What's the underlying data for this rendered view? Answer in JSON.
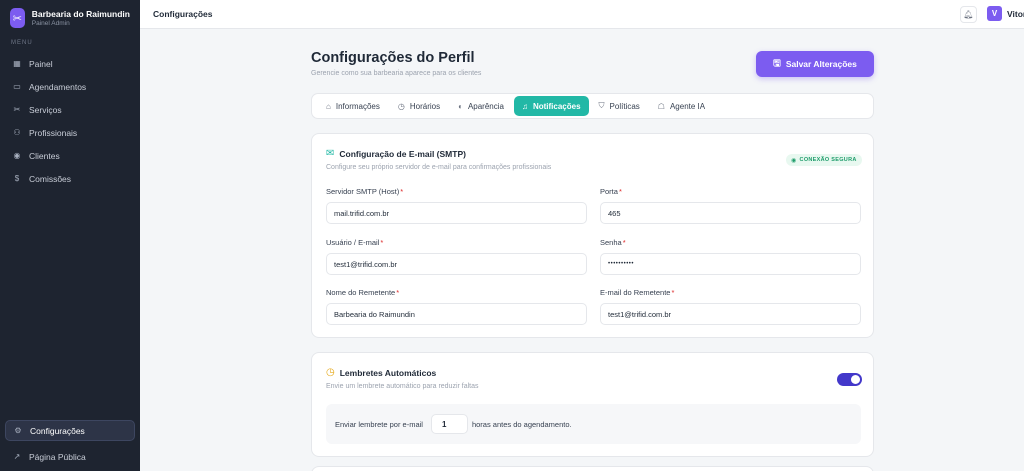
{
  "sidebar": {
    "brand_name": "Barbearia do Raimundin",
    "brand_sub": "Painel Admin",
    "menu_label": "MENU",
    "items": [
      {
        "label": "Painel",
        "icon": "grid-icon"
      },
      {
        "label": "Agendamentos",
        "icon": "calendar-icon"
      },
      {
        "label": "Serviços",
        "icon": "scissors-icon"
      },
      {
        "label": "Profissionais",
        "icon": "users-icon"
      },
      {
        "label": "Clientes",
        "icon": "user-circle-icon"
      },
      {
        "label": "Comissões",
        "icon": "dollar-icon"
      }
    ],
    "bottom": [
      {
        "label": "Configurações",
        "icon": "gear-icon",
        "active": true
      },
      {
        "label": "Página Pública",
        "icon": "external-link-icon"
      }
    ]
  },
  "topbar": {
    "title": "Configurações",
    "avatar_initial": "V",
    "username": "Vitor"
  },
  "page": {
    "title": "Configurações do Perfil",
    "subtitle": "Gerencie como sua barbearia aparece para os clientes",
    "save_label": "Salvar Alterações"
  },
  "tabs": [
    {
      "label": "Informações",
      "icon": "store-icon"
    },
    {
      "label": "Horários",
      "icon": "clock-icon"
    },
    {
      "label": "Aparência",
      "icon": "palette-icon"
    },
    {
      "label": "Notificações",
      "icon": "bell-icon",
      "active": true
    },
    {
      "label": "Políticas",
      "icon": "shield-icon"
    },
    {
      "label": "Agente IA",
      "icon": "robot-icon"
    }
  ],
  "smtp": {
    "title": "Configuração de E-mail (SMTP)",
    "subtitle": "Configure seu próprio servidor de e-mail para confirmações profissionais",
    "badge": "CONEXÃO SEGURA",
    "host_label": "Servidor SMTP (Host)",
    "host_value": "mail.trifid.com.br",
    "port_label": "Porta",
    "port_value": "465",
    "user_label": "Usuário / E-mail",
    "user_value": "test1@trifid.com.br",
    "pass_label": "Senha",
    "pass_value": "••••••••••",
    "sender_name_label": "Nome do Remetente",
    "sender_name_value": "Barbearia do Raimundin",
    "sender_email_label": "E-mail do Remetente",
    "sender_email_value": "test1@trifid.com.br"
  },
  "reminders": {
    "title": "Lembretes Automáticos",
    "subtitle": "Envie um lembrete automático para reduzir faltas",
    "enabled": true,
    "prefix": "Enviar lembrete por e-mail",
    "hours": "1",
    "suffix": "horas antes do agendamento."
  },
  "colors": {
    "accent": "#7c5cf0",
    "tab_active": "#22b8a6",
    "toggle_on": "#4338ca",
    "sidebar_bg": "#1e2430"
  }
}
